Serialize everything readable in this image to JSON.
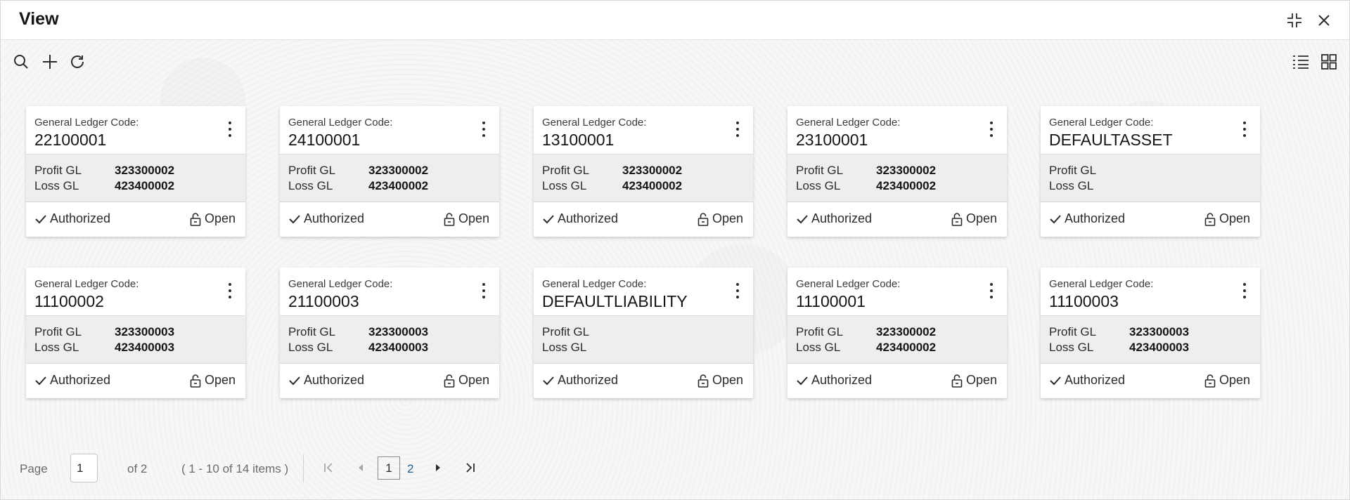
{
  "window": {
    "title": "View",
    "controls": [
      "collapse-icon",
      "close-icon"
    ]
  },
  "toolbar": {
    "left_icons": [
      "search-icon",
      "add-icon",
      "refresh-icon"
    ],
    "right_icons": [
      "list-view-icon",
      "grid-view-icon"
    ]
  },
  "cards": [
    {
      "label": "General Ledger Code:",
      "code": "22100001",
      "profit_label": "Profit GL",
      "profit_value": "323300002",
      "loss_label": "Loss GL",
      "loss_value": "423400002",
      "status": "Authorized",
      "state": "Open"
    },
    {
      "label": "General Ledger Code:",
      "code": "24100001",
      "profit_label": "Profit GL",
      "profit_value": "323300002",
      "loss_label": "Loss GL",
      "loss_value": "423400002",
      "status": "Authorized",
      "state": "Open"
    },
    {
      "label": "General Ledger Code:",
      "code": "13100001",
      "profit_label": "Profit GL",
      "profit_value": "323300002",
      "loss_label": "Loss GL",
      "loss_value": "423400002",
      "status": "Authorized",
      "state": "Open"
    },
    {
      "label": "General Ledger Code:",
      "code": "23100001",
      "profit_label": "Profit GL",
      "profit_value": "323300002",
      "loss_label": "Loss GL",
      "loss_value": "423400002",
      "status": "Authorized",
      "state": "Open"
    },
    {
      "label": "General Ledger Code:",
      "code": "DEFAULTASSET",
      "profit_label": "Profit GL",
      "profit_value": "",
      "loss_label": "Loss GL",
      "loss_value": "",
      "status": "Authorized",
      "state": "Open"
    },
    {
      "label": "General Ledger Code:",
      "code": "11100002",
      "profit_label": "Profit GL",
      "profit_value": "323300003",
      "loss_label": "Loss GL",
      "loss_value": "423400003",
      "status": "Authorized",
      "state": "Open"
    },
    {
      "label": "General Ledger Code:",
      "code": "21100003",
      "profit_label": "Profit GL",
      "profit_value": "323300003",
      "loss_label": "Loss GL",
      "loss_value": "423400003",
      "status": "Authorized",
      "state": "Open"
    },
    {
      "label": "General Ledger Code:",
      "code": "DEFAULTLIABILITY",
      "profit_label": "Profit GL",
      "profit_value": "",
      "loss_label": "Loss GL",
      "loss_value": "",
      "status": "Authorized",
      "state": "Open"
    },
    {
      "label": "General Ledger Code:",
      "code": "11100001",
      "profit_label": "Profit GL",
      "profit_value": "323300002",
      "loss_label": "Loss GL",
      "loss_value": "423400002",
      "status": "Authorized",
      "state": "Open"
    },
    {
      "label": "General Ledger Code:",
      "code": "11100003",
      "profit_label": "Profit GL",
      "profit_value": "323300003",
      "loss_label": "Loss GL",
      "loss_value": "423400003",
      "status": "Authorized",
      "state": "Open"
    }
  ],
  "pagination": {
    "page_label": "Page",
    "current_page": "1",
    "of_label": "of 2",
    "items_summary": "( 1 - 10 of 14 items )",
    "pages": [
      "1",
      "2"
    ]
  }
}
